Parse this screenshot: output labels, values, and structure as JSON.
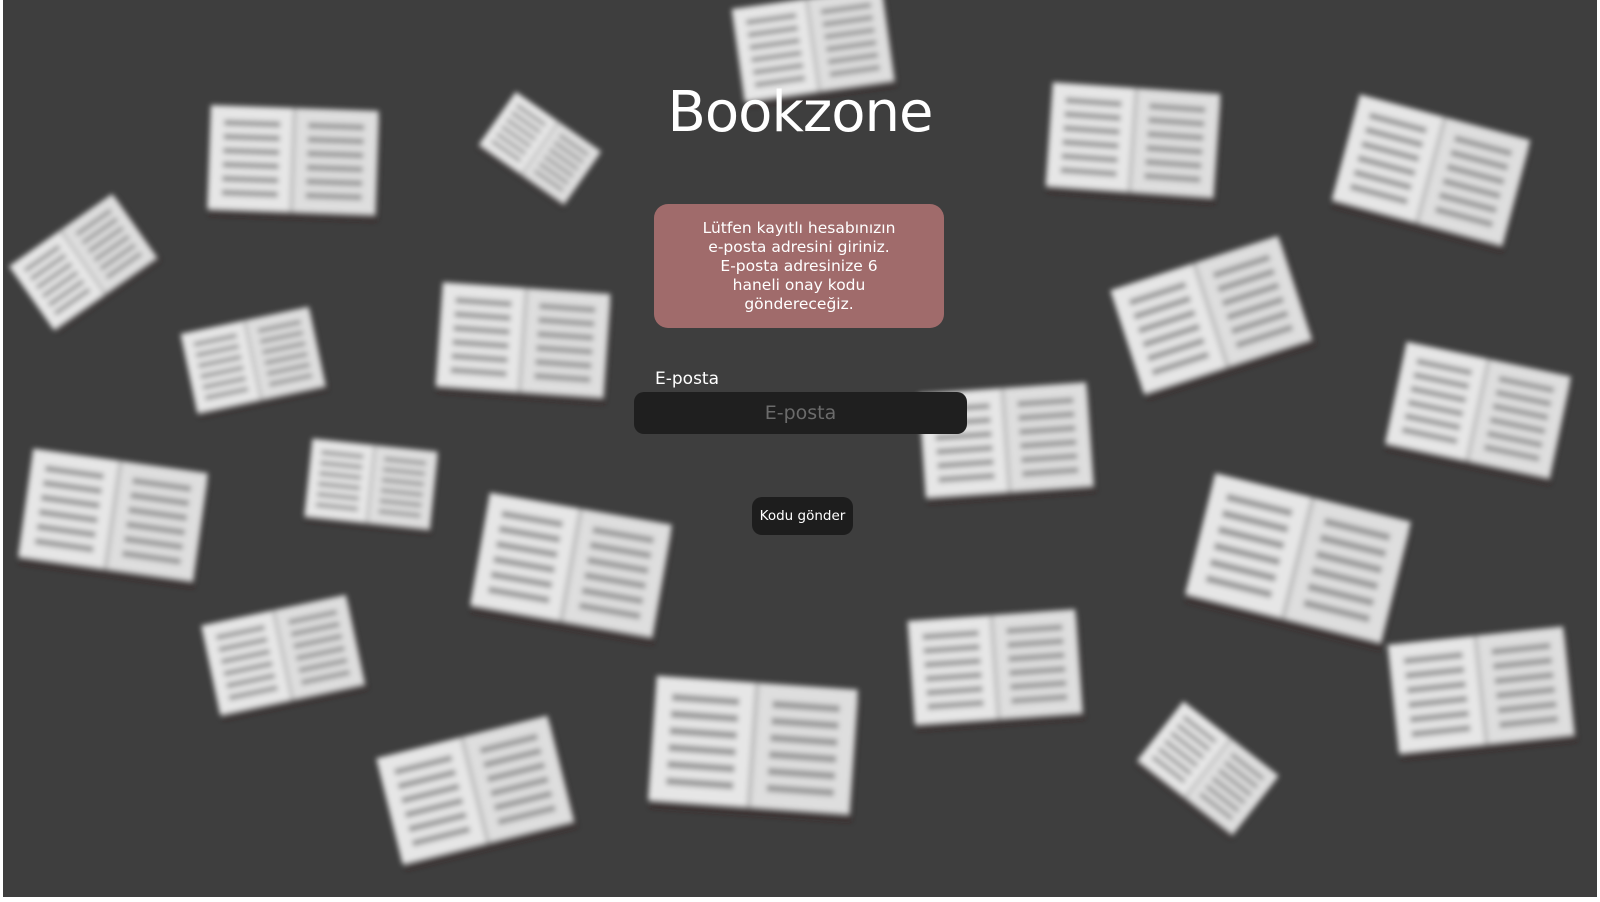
{
  "app": {
    "title": "Bookzone"
  },
  "info": {
    "message": "Lütfen kayıtlı hesabınızın\ne-posta adresini giriniz.\nE-posta adresinize 6\nhaneli onay kodu\ngöndereceğiz.",
    "background_color": "#a06b6b"
  },
  "form": {
    "email_label": "E-posta",
    "email_placeholder": "E-posta",
    "email_value": "",
    "submit_label": "Kodu gönder"
  },
  "background": {
    "decoration": "book-icon",
    "color": "#3e3e3e"
  }
}
